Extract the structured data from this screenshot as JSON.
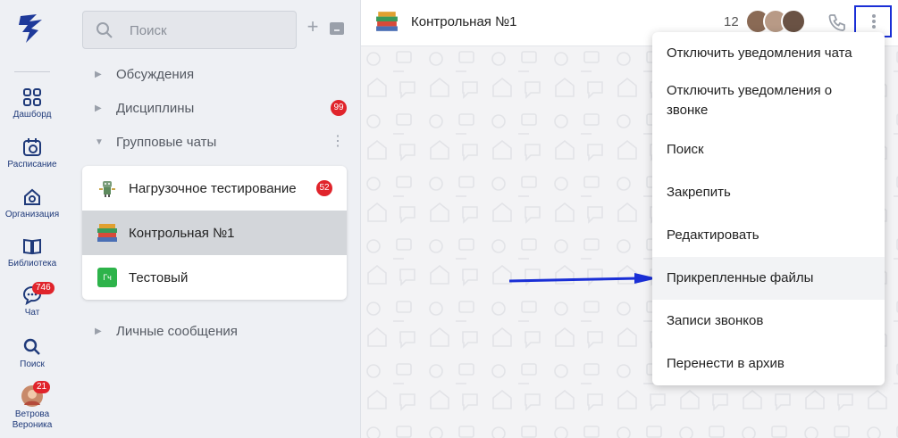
{
  "rail": {
    "items": [
      {
        "label": "Дашборд",
        "icon": "dashboard-icon"
      },
      {
        "label": "Расписание",
        "icon": "calendar-icon"
      },
      {
        "label": "Организация",
        "icon": "home-icon"
      },
      {
        "label": "Библиотека",
        "icon": "book-icon"
      },
      {
        "label": "Чат",
        "icon": "chat-icon",
        "badge": "746"
      },
      {
        "label": "Поиск",
        "icon": "search-icon"
      },
      {
        "label": "Ветрова Вероника",
        "icon": "avatar",
        "badge": "21"
      }
    ]
  },
  "panel": {
    "search_placeholder": "Поиск",
    "sections": [
      {
        "label": "Обсуждения",
        "expanded": false
      },
      {
        "label": "Дисциплины",
        "expanded": false,
        "badge": "99"
      },
      {
        "label": "Групповые чаты",
        "expanded": true
      },
      {
        "label": "Личные сообщения",
        "expanded": false
      }
    ],
    "group_chats": [
      {
        "name": "Нагрузочное тестирование",
        "badge": "52",
        "active": false
      },
      {
        "name": "Контрольная №1",
        "active": true
      },
      {
        "name": "Тестовый",
        "avatar_text": "Гч",
        "active": false
      }
    ]
  },
  "chat": {
    "title": "Контрольная №1",
    "member_count": "12"
  },
  "menu": {
    "items": [
      "Отключить уведомления чата",
      "Отключить уведомления о звонке",
      "Поиск",
      "Закрепить",
      "Редактировать",
      "Прикрепленные файлы",
      "Записи звонков",
      "Перенести в архив"
    ],
    "highlighted_index": 5
  },
  "colors": {
    "accent": "#1f3a7a",
    "badge": "#e0242b",
    "annotation": "#1a2fd6",
    "group_avatar": "#2db34a"
  }
}
